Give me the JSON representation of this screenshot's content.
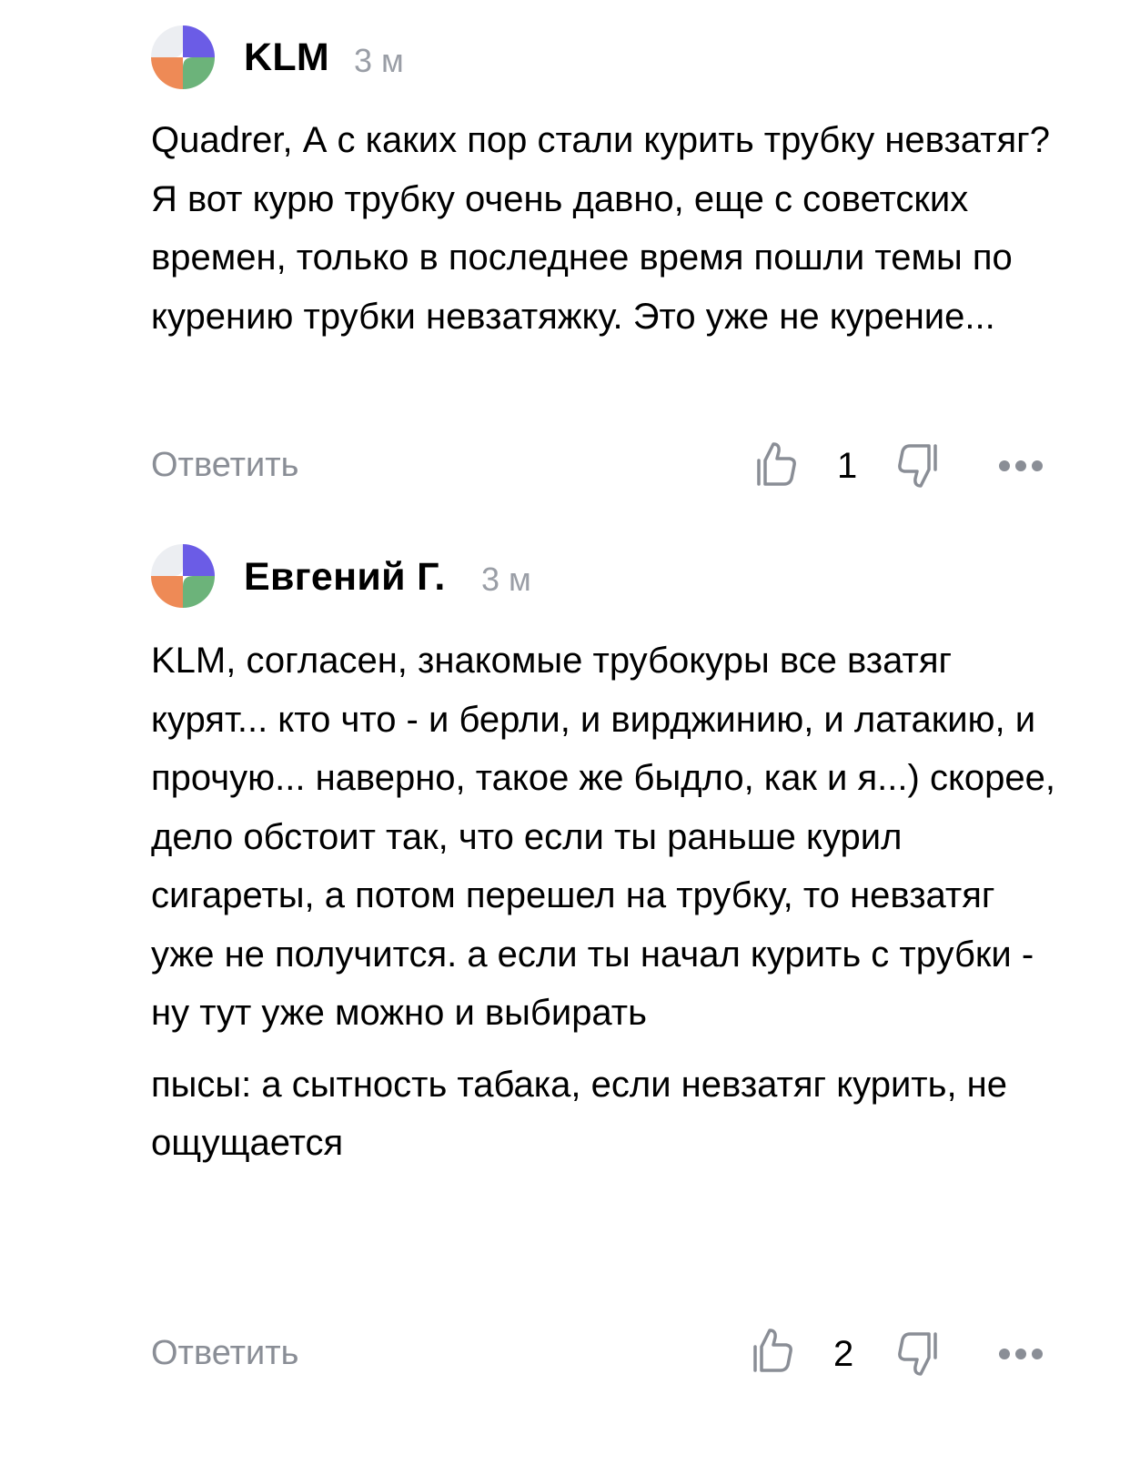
{
  "comments": [
    {
      "author": "KLM",
      "time": "3 м",
      "paragraphs": [
        "Quadrer, А с каких пор стали курить трубку невзатяг? Я вот курю трубку очень давно, еще с советских времен, только в последнее время пошли темы по курению трубки невзатяжку. Это уже не курение..."
      ],
      "reply_label": "Ответить",
      "likes": "1"
    },
    {
      "author": "Евгений Г.",
      "time": "3 м",
      "paragraphs": [
        "KLM, согласен, знакомые трубокуры все взатяг курят... кто что - и берли, и вирджинию, и латакию, и прочую... наверно, такое же быдло, как и я...) скорее, дело обстоит так, что если ты раньше курил сигареты, а потом перешел на трубку, то невзатяг уже не получится. а если ты начал курить с трубки - ну тут уже можно и выбирать",
        "пысы: а сытность табака, если невзатяг курить, не ощущается"
      ],
      "reply_label": "Ответить",
      "likes": "2"
    }
  ],
  "icons": {
    "like": "thumbs-up-icon",
    "dislike": "thumbs-down-icon",
    "more": "more-horizontal-icon"
  },
  "colors": {
    "avatar_purple": "#6b5ce6",
    "avatar_orange": "#ee8a56",
    "avatar_green": "#6cb37a",
    "avatar_gray": "#eceef2",
    "meta_gray": "#9a9ea6"
  }
}
